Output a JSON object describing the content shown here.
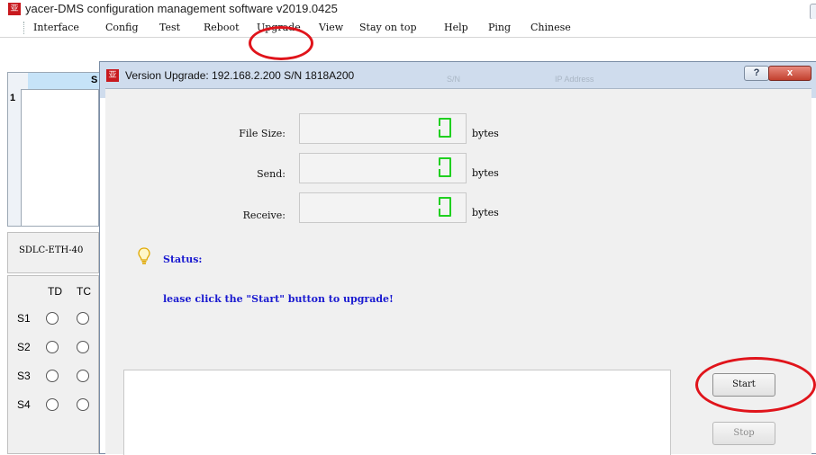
{
  "window": {
    "title": "yacer-DMS configuration management software v2019.0425",
    "app_icon": "亚"
  },
  "menu": {
    "items": [
      "Interface",
      "Config",
      "Test",
      "Reboot",
      "Upgrade",
      "View",
      "Stay on top",
      "Help",
      "Ping",
      "Chinese"
    ],
    "highlighted": "Upgrade"
  },
  "background": {
    "grid_row": "1",
    "grid_header_fragment": "S",
    "device": "SDLC-ETH-40",
    "io_headers": [
      "TD",
      "TC"
    ],
    "io_rows": [
      "S1",
      "S2",
      "S3",
      "S4"
    ]
  },
  "dialog": {
    "title": "Version Upgrade: 192.168.2.200  S/N 1818A200",
    "header_fragments": [
      "S/N",
      "IP Address"
    ],
    "help_label": "?",
    "close_label": "x",
    "fields": [
      {
        "label": "File Size:",
        "value": "0",
        "unit": "bytes"
      },
      {
        "label": "Send:",
        "value": "0",
        "unit": "bytes"
      },
      {
        "label": "Receive:",
        "value": "0",
        "unit": "bytes"
      }
    ],
    "status_label": "Status:",
    "status_message": "lease click the \"Start\" button to upgrade!",
    "start_button": "Start",
    "stop_button": "Stop"
  },
  "colors": {
    "annotation_ring": "#e0141b",
    "status_text": "#1a1ad0",
    "lcd_digit": "#20d020",
    "app_icon": "#c8191e"
  }
}
